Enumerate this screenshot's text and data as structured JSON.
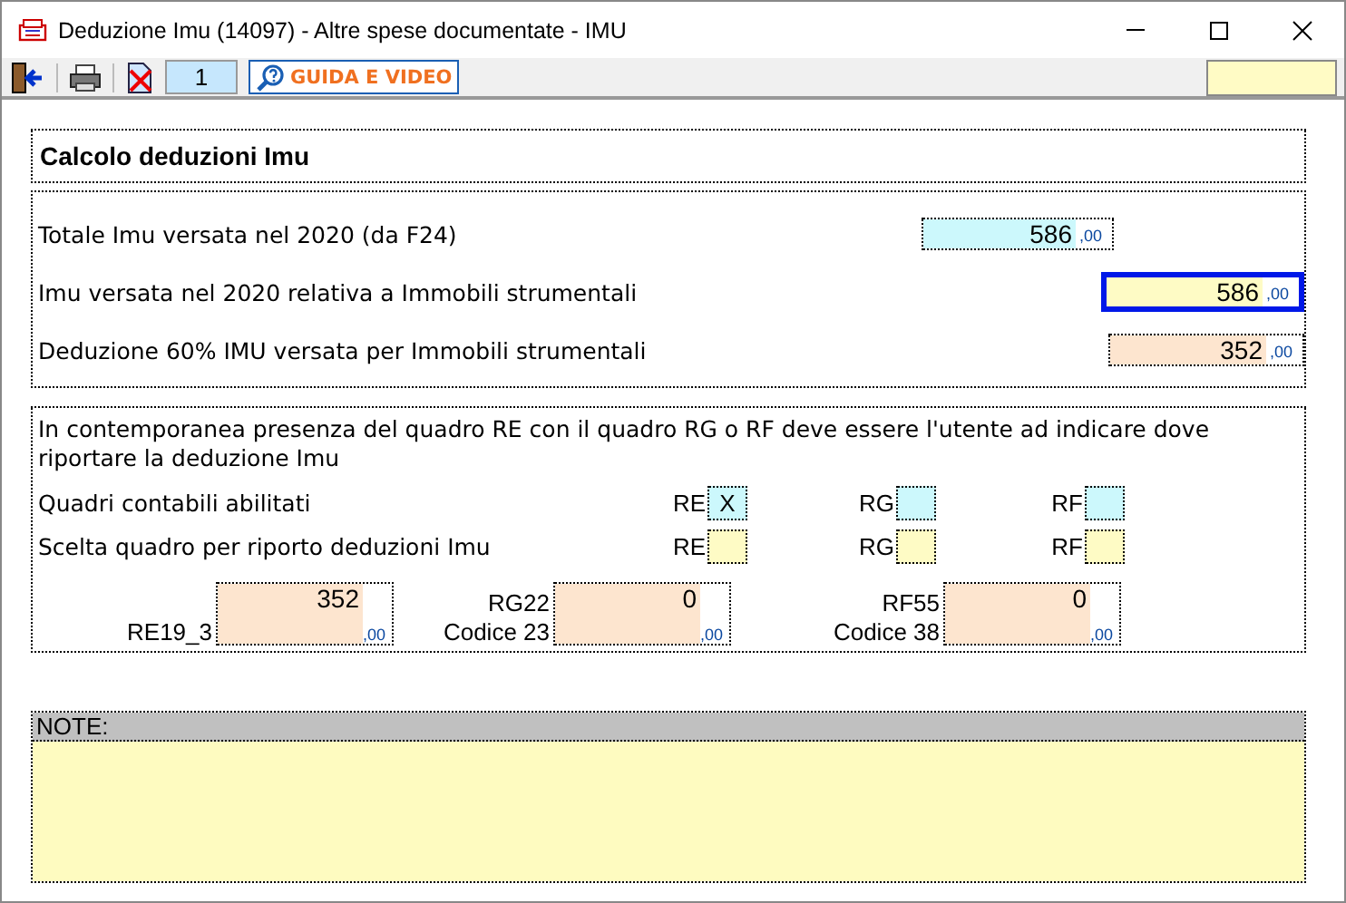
{
  "window": {
    "title": "Deduzione Imu (14097) - Altre spese documentate - IMU"
  },
  "toolbar": {
    "page": "1",
    "guide_button": "GUIDA E VIDEO"
  },
  "heading": "Calcolo deduzioni Imu",
  "amounts": [
    {
      "label": "Totale Imu versata nel 2020 (da F24)",
      "value": "586",
      "decimals": ",00",
      "kind": "import",
      "focused": false
    },
    {
      "label": "Imu versata nel 2020 relativa a Immobili strumentali",
      "value": "586",
      "decimals": ",00",
      "kind": "input",
      "focused": true
    },
    {
      "label": "Deduzione 60% IMU versata per Immobili strumentali",
      "value": "352",
      "decimals": ",00",
      "kind": "result",
      "focused": false
    }
  ],
  "note_text": "In contemporanea presenza del quadro RE con il quadro RG o RF deve essere l'utente ad indicare dove riportare la deduzione Imu",
  "choice_rows": [
    {
      "label": "Quadri contabili abilitati",
      "kind": "import",
      "boxes": [
        {
          "label": "RE",
          "value": "X"
        },
        {
          "label": "RG"
        },
        {
          "label": "RF"
        }
      ]
    },
    {
      "label": "Scelta quadro per riporto deduzioni Imu",
      "kind": "input",
      "boxes": [
        {
          "label": "RE"
        },
        {
          "label": "RG"
        },
        {
          "label": "RF"
        }
      ]
    }
  ],
  "transfers": [
    {
      "labels": [
        "RE19_3"
      ],
      "value": "352",
      "decimals": ",00"
    },
    {
      "labels": [
        "RG22",
        "Codice 23"
      ],
      "value": "0",
      "decimals": ",00"
    },
    {
      "labels": [
        "RF55",
        "Codice 38"
      ],
      "value": "0",
      "decimals": ",00"
    }
  ],
  "notes": {
    "label": "NOTE:"
  }
}
